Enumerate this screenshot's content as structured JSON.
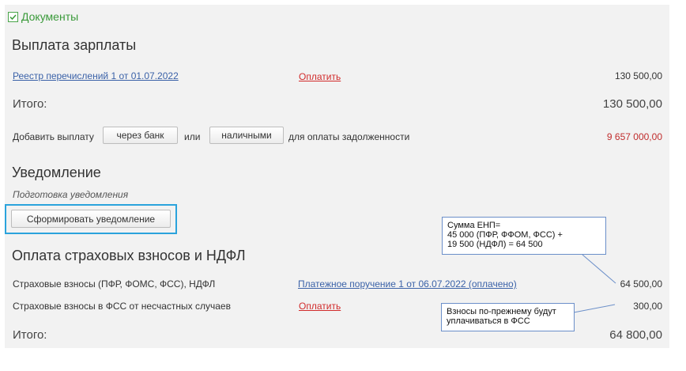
{
  "documents": {
    "label": "Документы"
  },
  "salary": {
    "title": "Выплата зарплаты",
    "registry_link": "Реестр перечислений 1 от 01.07.2022",
    "pay_link": "Оплатить",
    "registry_amount": "130 500,00",
    "total_label": "Итого:",
    "total_amount": "130 500,00",
    "add_payment_label": "Добавить выплату",
    "bank_button": "через банк",
    "or_label": "или",
    "cash_button": "наличными",
    "debt_label": "для оплаты задолженности",
    "debt_amount": "9 657 000,00"
  },
  "notification": {
    "title": "Уведомление",
    "preparing_label": "Подготовка уведомления",
    "form_button": "Сформировать уведомление"
  },
  "insurance": {
    "title": "Оплата страховых взносов и НДФЛ",
    "rows": [
      {
        "label": "Страховые взносы (ПФР, ФОМС, ФСС), НДФЛ",
        "link": "Платежное поручение 1 от 06.07.2022 (оплачено)",
        "amount": "64 500,00"
      },
      {
        "label": "Страховые взносы в ФСС от несчастных случаев",
        "link": "Оплатить",
        "amount": "300,00"
      }
    ],
    "total_label": "Итого:",
    "total_amount": "64 800,00"
  },
  "callouts": {
    "enp": {
      "lines": [
        "Сумма ЕНП=",
        "45 000 (ПФР, ФФОМ, ФСС) +",
        "19 500 (НДФЛ) = 64 500"
      ]
    },
    "fss": {
      "lines": [
        "Взносы по-прежнему будут",
        "уплачиваться в ФСС"
      ]
    }
  },
  "colors": {
    "docs_green": "#3a9a3a",
    "link_blue": "#3b62a8",
    "pay_red": "#d12b2b",
    "debt_red": "#c02d2d",
    "highlight_blue": "#2ba3dc",
    "callout_border": "#6b8fc9"
  }
}
